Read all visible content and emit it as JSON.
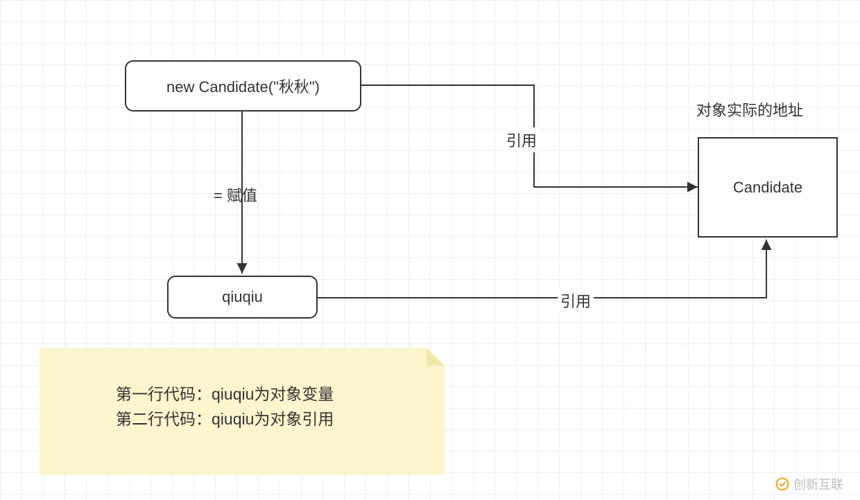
{
  "nodes": {
    "constructor_call": "new Candidate(\"秋秋\")",
    "variable": "qiuqiu",
    "object_box": "Candidate"
  },
  "labels": {
    "assign": "= 赋值",
    "ref1": "引用",
    "ref2": "引用",
    "actual_addr": "对象实际的地址"
  },
  "note": {
    "line1": "第一行代码：qiuqiu为对象变量",
    "line2": "第二行代码：qiuqiu为对象引用"
  },
  "watermark": "创新互联",
  "chart_data": {
    "type": "diagram",
    "title": "",
    "description": "Java object reference diagram showing that a variable holds a reference to the actual Candidate object in memory.",
    "nodes": [
      {
        "id": "constructor_call",
        "label": "new Candidate(\"秋秋\")",
        "shape": "rounded-rect"
      },
      {
        "id": "variable",
        "label": "qiuqiu",
        "shape": "rounded-rect"
      },
      {
        "id": "object_box",
        "label": "Candidate",
        "shape": "rect",
        "annotation": "对象实际的地址"
      }
    ],
    "edges": [
      {
        "from": "constructor_call",
        "to": "variable",
        "label": "= 赋值",
        "kind": "assignment"
      },
      {
        "from": "constructor_call",
        "to": "object_box",
        "label": "引用",
        "kind": "reference"
      },
      {
        "from": "variable",
        "to": "object_box",
        "label": "引用",
        "kind": "reference"
      }
    ],
    "note": [
      "第一行代码：qiuqiu为对象变量",
      "第二行代码：qiuqiu为对象引用"
    ]
  }
}
